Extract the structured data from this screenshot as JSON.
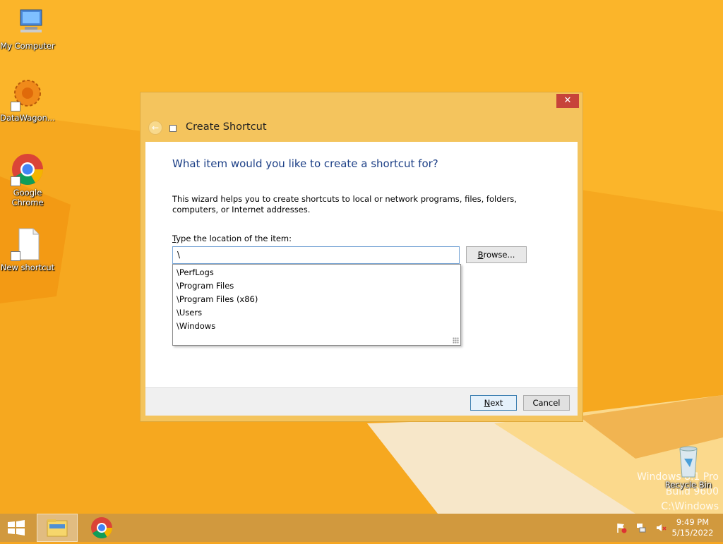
{
  "desktop": {
    "icons": [
      {
        "label": "My Computer",
        "icon": "computer-icon"
      },
      {
        "label": "DataWagon...",
        "icon": "datawagon-icon"
      },
      {
        "label": "Google Chrome",
        "icon": "chrome-icon"
      },
      {
        "label": "New shortcut",
        "icon": "document-shortcut-icon"
      },
      {
        "label": "Recycle Bin",
        "icon": "recycle-bin-icon"
      }
    ],
    "watermark": {
      "line1": "Windows 8.1 Pro",
      "line2": "Build 9600",
      "line3": "C:\\Windows"
    },
    "colors": {
      "wallpaper": "#f5a623",
      "accent": "#1c3f86",
      "close": "#c7433a"
    }
  },
  "dialog": {
    "title": "Create Shortcut",
    "close_label": "✕",
    "heading": "What item would you like to create a shortcut for?",
    "description": "This wizard helps you to create shortcuts to local or network programs, files, folders, computers, or Internet addresses.",
    "location_label_first": "T",
    "location_label_rest": "ype the location of the item:",
    "location_value": "\\",
    "browse_label_first": "B",
    "browse_label_rest": "rowse...",
    "autocomplete": [
      "\\PerfLogs",
      "\\Program Files",
      "\\Program Files (x86)",
      "\\Users",
      "\\Windows"
    ],
    "next_label_first": "N",
    "next_label_rest": "ext",
    "cancel_label": "Cancel"
  },
  "taskbar": {
    "time": "9:49 PM",
    "date": "5/15/2022"
  }
}
